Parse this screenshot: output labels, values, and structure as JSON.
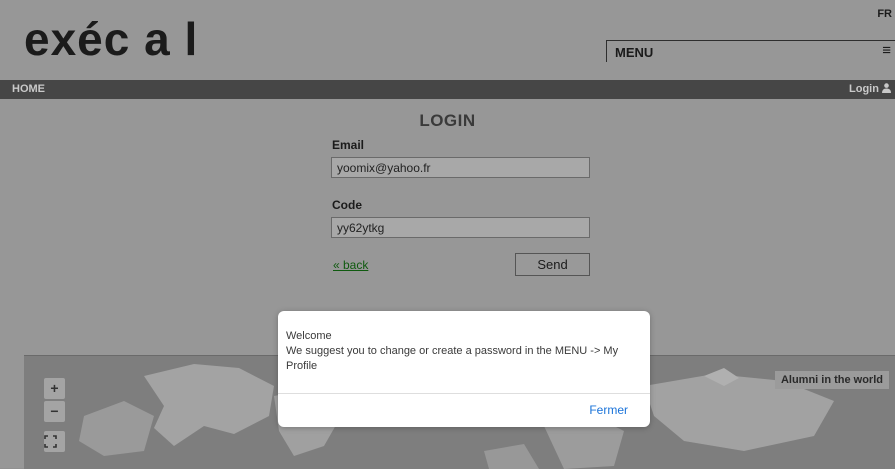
{
  "header": {
    "logo": "exéc a l",
    "lang": "FR",
    "menu_label": "MENU",
    "menu_icon": "hamburger-menu-icon"
  },
  "nav": {
    "home": "HOME",
    "login": "Login",
    "login_icon": "user-icon"
  },
  "login": {
    "title": "LOGIN",
    "email_label": "Email",
    "email_value": "yoomix@yahoo.fr",
    "code_label": "Code",
    "code_value": "yy62ytkg",
    "back_link": "« back",
    "send_label": "Send"
  },
  "map": {
    "title": "Alumni in the world",
    "zoom_in": "+",
    "zoom_out": "−",
    "fullscreen_icon": "fullscreen-icon"
  },
  "dialog": {
    "line1": "Welcome",
    "line2": "We suggest you to change or create a password in the MENU -> My Profile",
    "button": "Fermer"
  }
}
